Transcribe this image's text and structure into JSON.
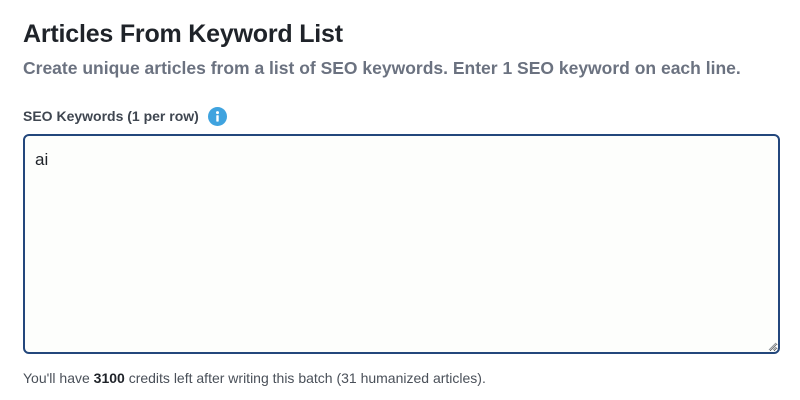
{
  "header": {
    "title": "Articles From Keyword List",
    "subtitle": "Create unique articles from a list of SEO keywords. Enter 1 SEO keyword on each line."
  },
  "keywords_field": {
    "label": "SEO Keywords (1 per row)",
    "value": "ai",
    "info_icon": "info-icon"
  },
  "credits": {
    "prefix": "You'll have ",
    "amount": "3100",
    "suffix": " credits left after writing this batch (31 humanized articles)."
  },
  "colors": {
    "accent_border": "#23477c",
    "info_icon": "#3fa3df",
    "title": "#1f2329",
    "subtitle": "#6b7280"
  }
}
